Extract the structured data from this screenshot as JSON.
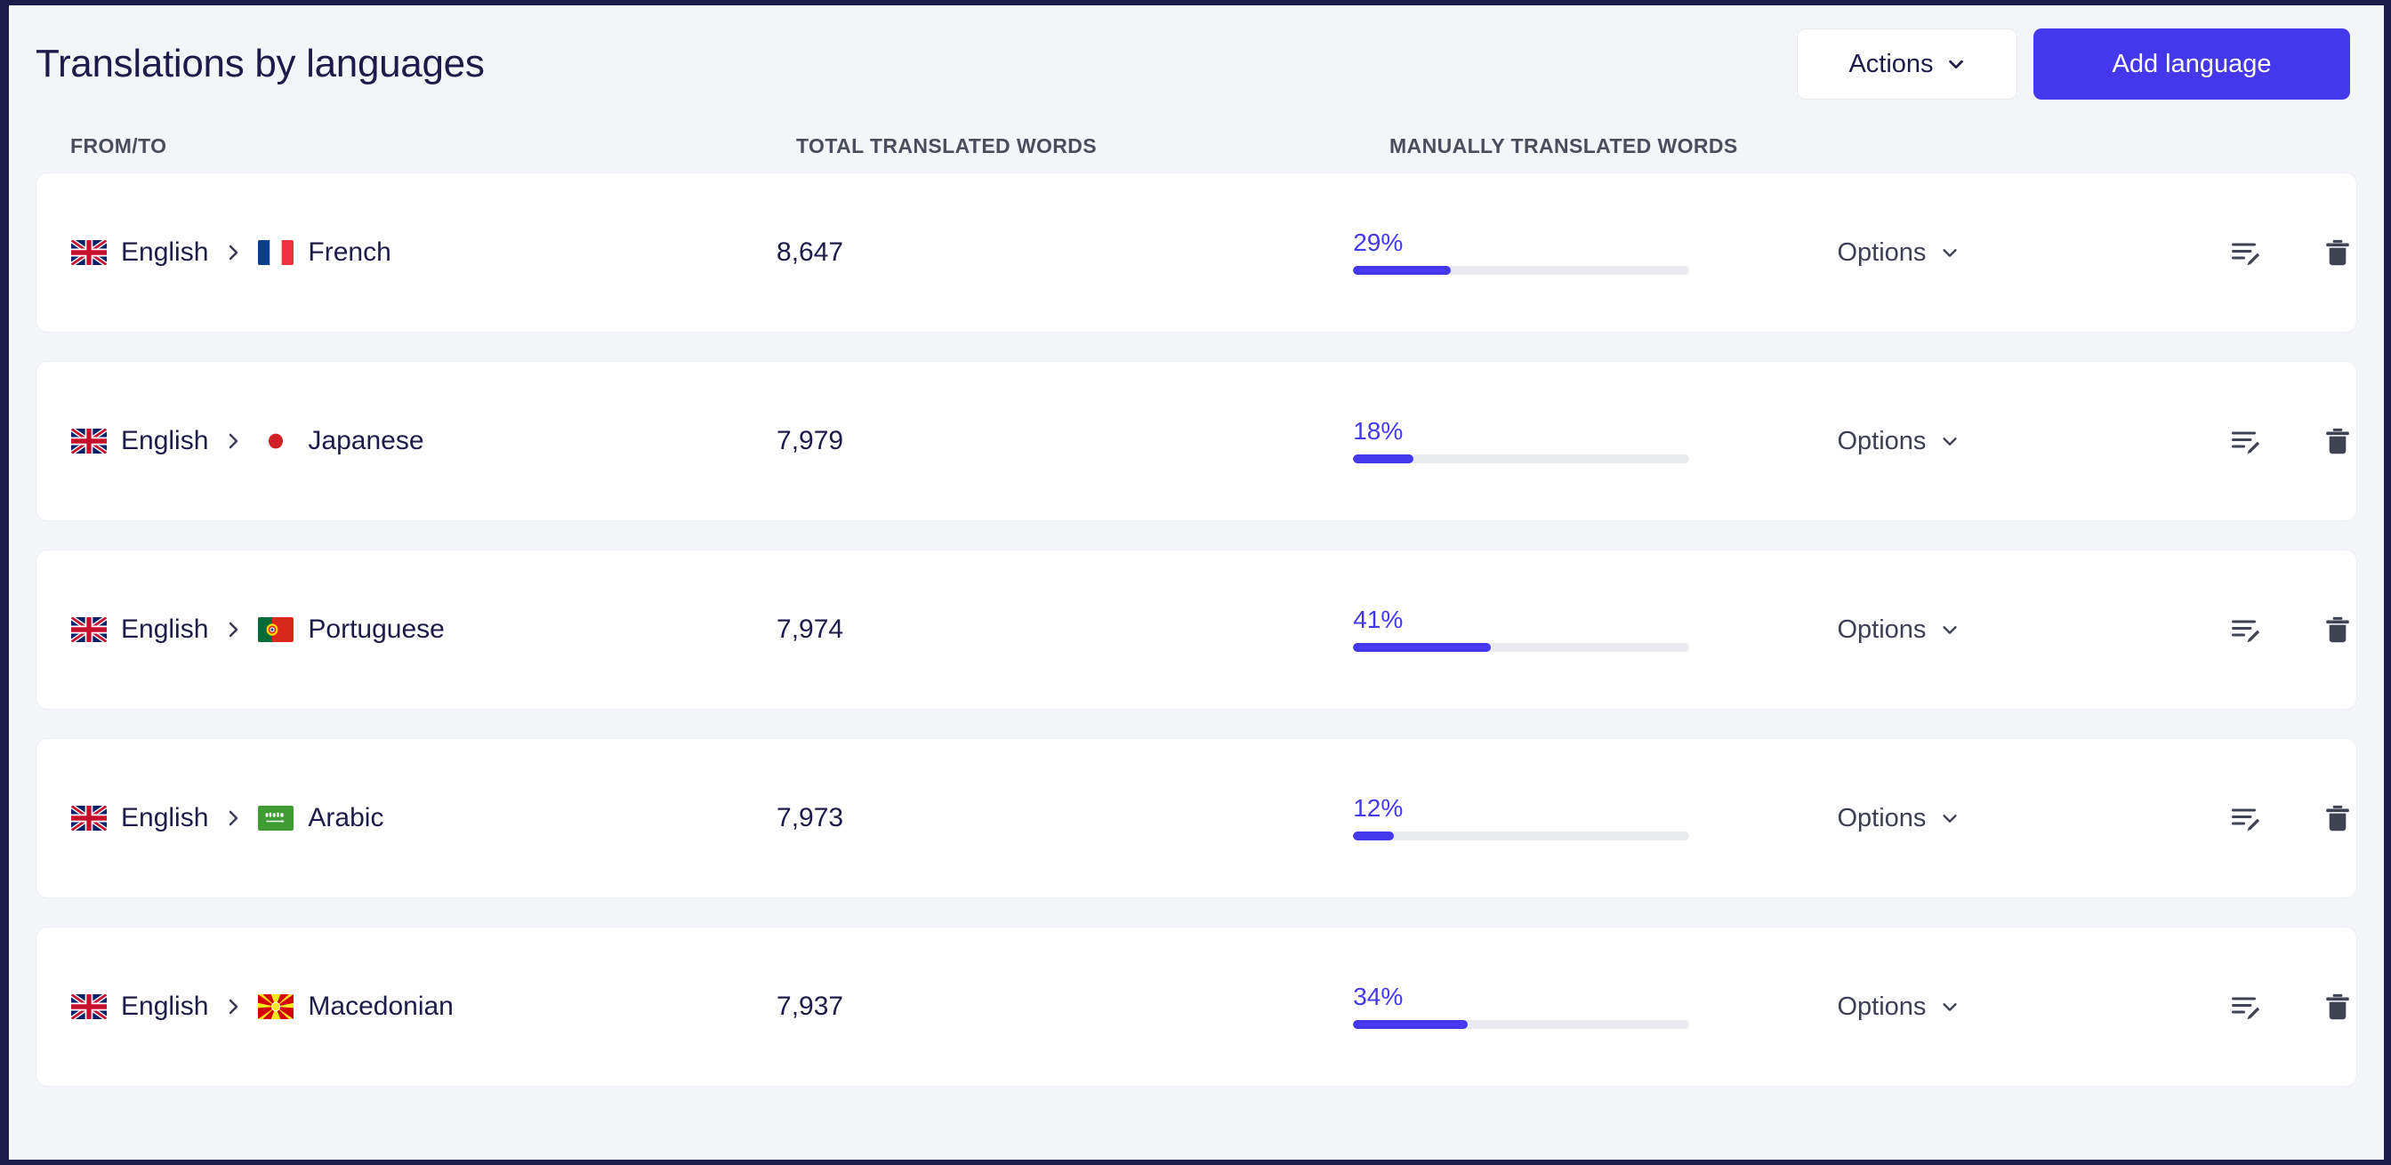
{
  "header": {
    "title": "Translations by languages",
    "actions_label": "Actions",
    "add_language_label": "Add language"
  },
  "table": {
    "columns": {
      "from_to": "FROM/TO",
      "total_translated_words": "TOTAL TRANSLATED WORDS",
      "manually_translated_words": "MANUALLY TRANSLATED WORDS"
    },
    "options_label": "Options",
    "rows": [
      {
        "source_language": "English",
        "source_flag": "uk-flag",
        "target_language": "French",
        "target_flag": "france-flag",
        "total_translated_words": "8,647",
        "manual_percent_label": "29%",
        "manual_percent": 29
      },
      {
        "source_language": "English",
        "source_flag": "uk-flag",
        "target_language": "Japanese",
        "target_flag": "japan-flag",
        "total_translated_words": "7,979",
        "manual_percent_label": "18%",
        "manual_percent": 18
      },
      {
        "source_language": "English",
        "source_flag": "uk-flag",
        "target_language": "Portuguese",
        "target_flag": "portugal-flag",
        "total_translated_words": "7,974",
        "manual_percent_label": "41%",
        "manual_percent": 41
      },
      {
        "source_language": "English",
        "source_flag": "uk-flag",
        "target_language": "Arabic",
        "target_flag": "saudi-arabia-flag",
        "total_translated_words": "7,973",
        "manual_percent_label": "12%",
        "manual_percent": 12
      },
      {
        "source_language": "English",
        "source_flag": "uk-flag",
        "target_language": "Macedonian",
        "target_flag": "macedonia-flag",
        "total_translated_words": "7,937",
        "manual_percent_label": "34%",
        "manual_percent": 34
      }
    ]
  },
  "colors": {
    "accent": "#4338ec",
    "title": "#1d1b49",
    "page_bg": "#f4f5f9",
    "frame": "#1d1b49",
    "track": "#e9eaee"
  }
}
